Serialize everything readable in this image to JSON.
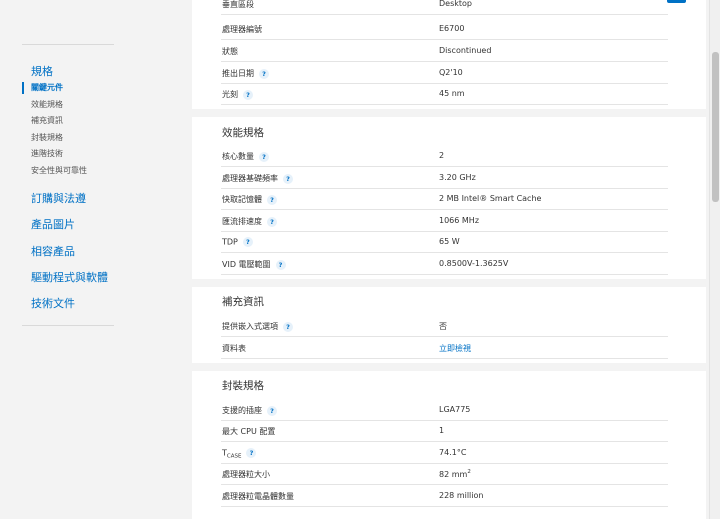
{
  "sidebar": {
    "heading": "規格",
    "subitems": [
      "關鍵元件",
      "效能規格",
      "補充資訊",
      "封裝規格",
      "進階技術",
      "安全性與可靠性"
    ],
    "links": [
      "訂購與法遵",
      "產品圖片",
      "相容產品",
      "驅動程式與軟體",
      "技術文件"
    ]
  },
  "key_rows": [
    {
      "label": "垂直區段",
      "value": "Desktop"
    },
    {
      "label": "處理器編號",
      "value": "E6700"
    },
    {
      "label": "狀態",
      "value": "Discontinued"
    },
    {
      "label": "推出日期",
      "value": "Q2'10"
    },
    {
      "label": "光刻",
      "value": "45 nm"
    }
  ],
  "perf": {
    "title": "效能規格",
    "rows": [
      {
        "label": "核心數量",
        "value": "2"
      },
      {
        "label": "處理器基礎頻率",
        "value": "3.20 GHz"
      },
      {
        "label": "快取記憶體",
        "value": "2 MB Intel® Smart Cache"
      },
      {
        "label": "匯流排速度",
        "value": "1066 MHz"
      },
      {
        "label": "TDP",
        "value": "65 W"
      },
      {
        "label": "VID 電壓範圍",
        "value": "0.8500V-1.3625V"
      }
    ]
  },
  "supp": {
    "title": "補充資訊",
    "rows": [
      {
        "label": "提供嵌入式選項",
        "value": "否"
      },
      {
        "label": "資料表",
        "value": "立即檢視"
      }
    ]
  },
  "pkg": {
    "title": "封裝規格",
    "rows": [
      {
        "label": "支援的插座",
        "value": "LGA775"
      },
      {
        "label": "最大 CPU 配置",
        "value": "1"
      },
      {
        "label_main": "T",
        "label_sub": "CASE",
        "value": "74.1°C"
      },
      {
        "label": "處理器粒大小",
        "value": "82 mm",
        "value_sup": "2"
      },
      {
        "label": "處理器粒電晶體數量",
        "value": "228 million"
      }
    ]
  },
  "help_glyph": "?",
  "icons": {
    "help": "question-circle-icon"
  },
  "colors": {
    "link": "#0071c5",
    "background": "#f3f3f3",
    "panel": "#ffffff"
  }
}
